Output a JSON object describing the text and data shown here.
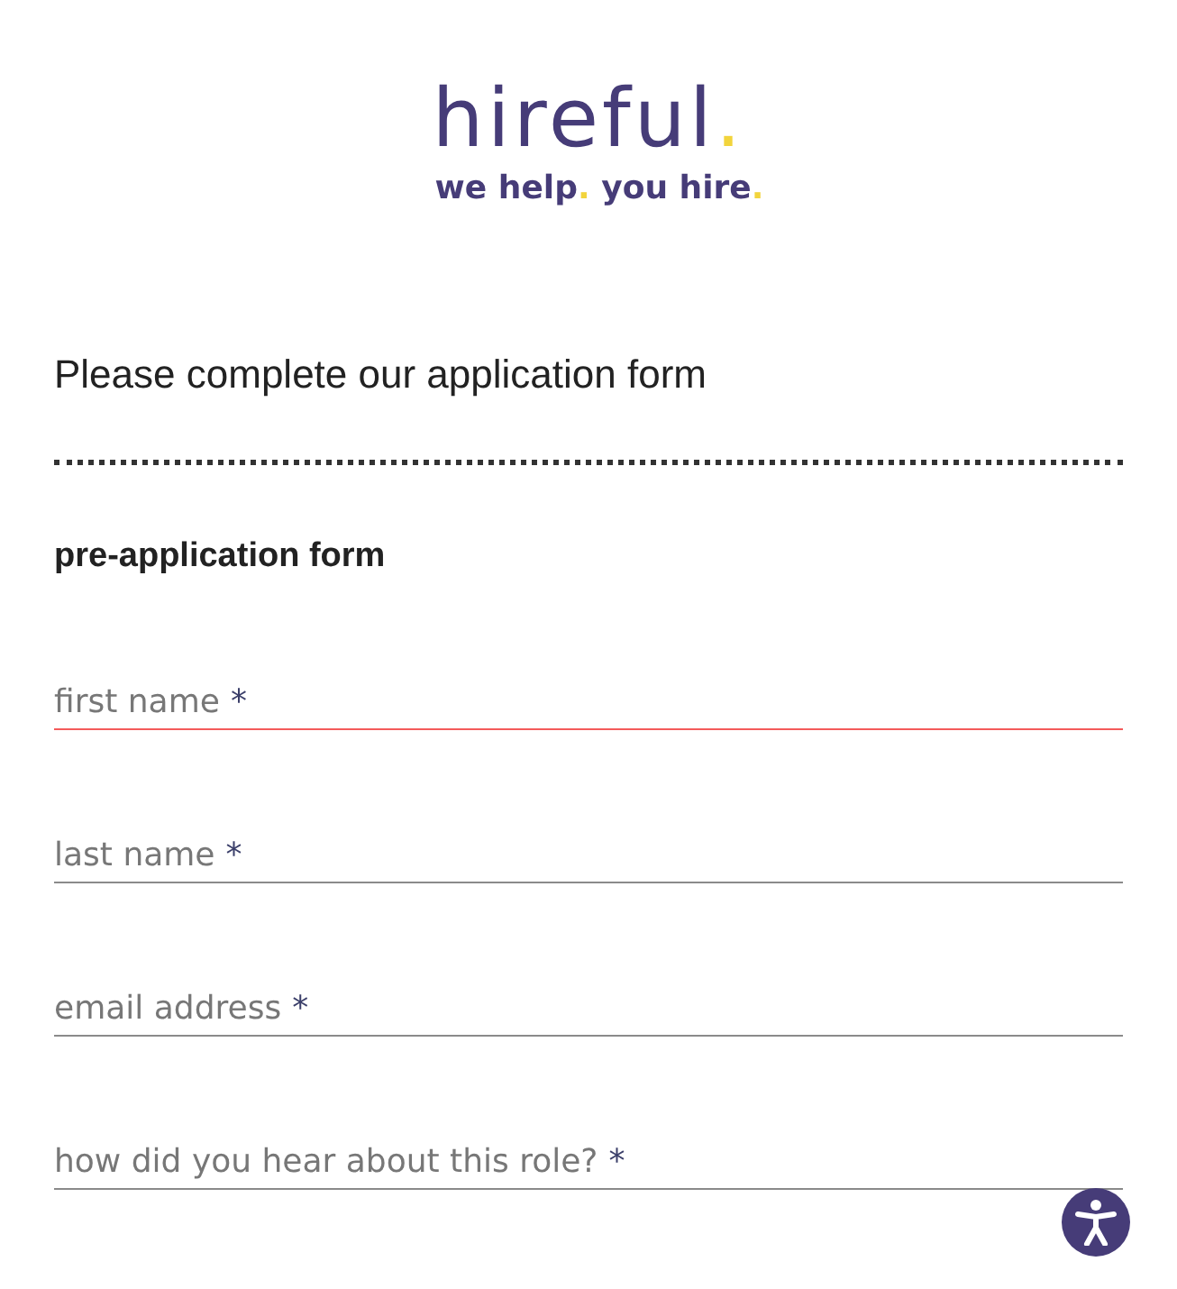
{
  "logo": {
    "name": "hireful",
    "mark": ".",
    "tagline": [
      {
        "text": "we help",
        "accent": false
      },
      {
        "text": ".",
        "accent": true
      },
      {
        "text": " you hire",
        "accent": false
      },
      {
        "text": ".",
        "accent": true
      }
    ]
  },
  "heading": "Please complete our application form",
  "section": "pre-application form",
  "fields": [
    {
      "label": "first name",
      "required_mark": "*",
      "invalid": true
    },
    {
      "label": "last name",
      "required_mark": "*",
      "invalid": false
    },
    {
      "label": "email address",
      "required_mark": "*",
      "invalid": false
    },
    {
      "label": "how did you hear about this role?",
      "required_mark": "*",
      "invalid": false
    }
  ]
}
